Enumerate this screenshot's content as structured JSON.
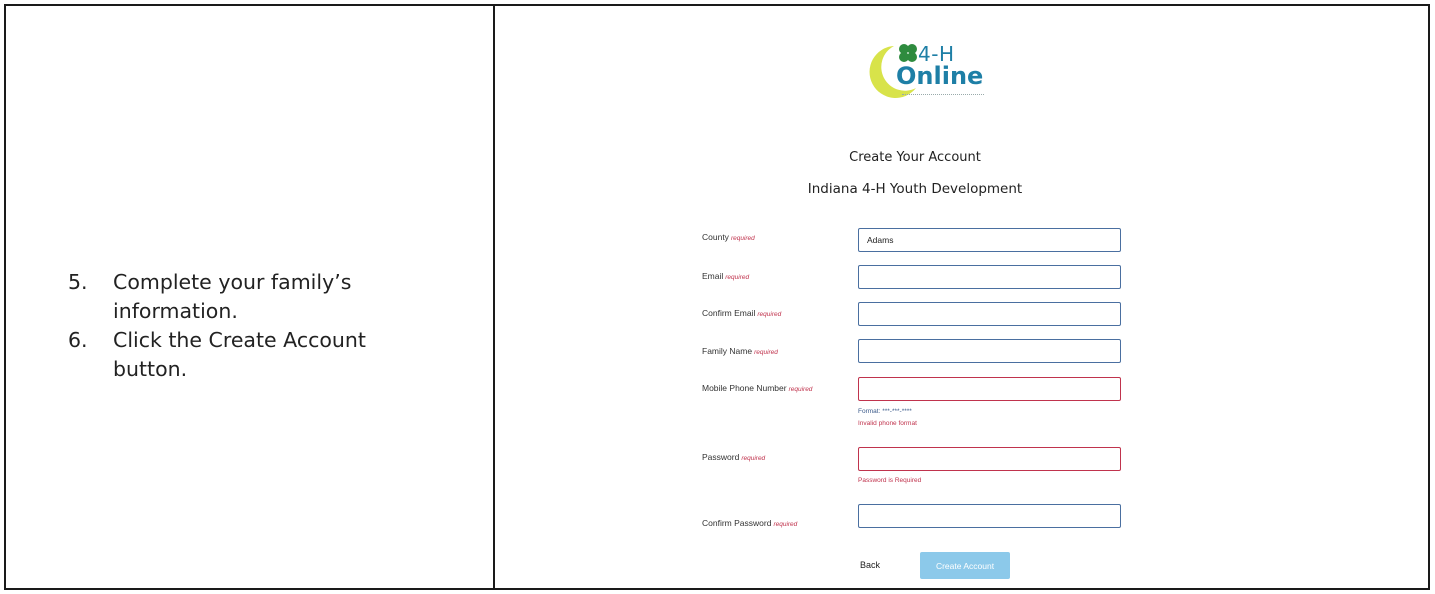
{
  "instructions": {
    "steps": [
      {
        "number": "5.",
        "text": "Complete your family’s information."
      },
      {
        "number": "6.",
        "text": "Click the Create Account button."
      }
    ]
  },
  "logo": {
    "line1": "4-H",
    "line2": "Online"
  },
  "form": {
    "title": "Create Your Account",
    "subtitle": "Indiana 4-H Youth Development",
    "required_marker": "required",
    "fields": {
      "county": {
        "label": "County",
        "value": "Adams"
      },
      "email": {
        "label": "Email",
        "value": ""
      },
      "confirm_email": {
        "label": "Confirm Email",
        "value": ""
      },
      "family_name": {
        "label": "Family Name",
        "value": ""
      },
      "mobile_phone": {
        "label": "Mobile Phone Number",
        "value": "",
        "format_hint": "Format: ***-***-****",
        "error": "Invalid phone format"
      },
      "password": {
        "label": "Password",
        "value": "",
        "error": "Password is Required"
      },
      "confirm_password": {
        "label": "Confirm Password",
        "value": ""
      }
    },
    "buttons": {
      "back": "Back",
      "create": "Create Account"
    }
  },
  "colors": {
    "accent": "#1e7fa6",
    "error": "#c0334d",
    "button": "#8cc9ea"
  }
}
